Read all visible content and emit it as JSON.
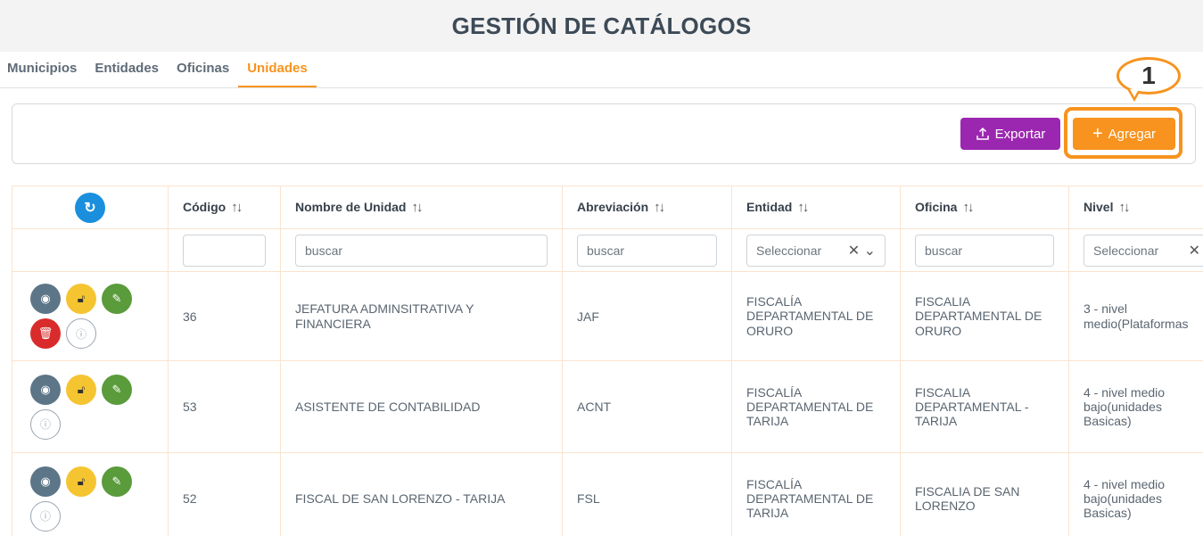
{
  "page": {
    "title": "GESTIÓN DE CATÁLOGOS"
  },
  "tabs": [
    "Municipios",
    "Entidades",
    "Oficinas",
    "Unidades"
  ],
  "active_tab": "Unidades",
  "toolbar": {
    "export_label": "Exportar",
    "add_label": "Agregar"
  },
  "annotation": {
    "callout_number": "1"
  },
  "table": {
    "columns": [
      "Código",
      "Nombre de Unidad",
      "Abreviación",
      "Entidad",
      "Oficina",
      "Nivel"
    ],
    "filters": {
      "codigo": "",
      "nombre_placeholder": "buscar",
      "abreviacion_placeholder": "buscar",
      "entidad_placeholder": "Seleccionar",
      "oficina_placeholder": "buscar",
      "nivel_placeholder": "Seleccionar"
    },
    "rows": [
      {
        "codigo": "36",
        "nombre": "JEFATURA ADMINSITRATIVA Y FINANCIERA",
        "abreviacion": "JAF",
        "entidad": "FISCALÍA DEPARTAMENTAL DE ORURO",
        "oficina": "FISCALIA DEPARTAMENTAL DE ORURO",
        "nivel": "3 - nivel medio(Plataformas"
      },
      {
        "codigo": "53",
        "nombre": "ASISTENTE DE CONTABILIDAD",
        "abreviacion": "ACNT",
        "entidad": "FISCALÍA DEPARTAMENTAL DE TARIJA",
        "oficina": "FISCALIA DEPARTAMENTAL - TARIJA",
        "nivel": "4 - nivel medio bajo(unidades Basicas)"
      },
      {
        "codigo": "52",
        "nombre": "FISCAL DE SAN LORENZO - TARIJA",
        "abreviacion": "FSL",
        "entidad": "FISCALÍA DEPARTAMENTAL DE TARIJA",
        "oficina": "FISCALIA DE SAN LORENZO",
        "nivel": "4 - nivel medio bajo(unidades Basicas)"
      }
    ]
  },
  "icons": {
    "refresh": "refresh-icon",
    "view": "eye-icon",
    "unlock": "unlock-icon",
    "edit": "pencil-icon",
    "delete": "trash-icon",
    "info": "info-icon",
    "export": "upload-icon",
    "add": "plus-icon",
    "sort": "sort-icon"
  },
  "colors": {
    "accent": "#f7931e",
    "export": "#9b27b0",
    "refresh": "#1a8fdd",
    "view": "#5c7688",
    "unlock": "#f5c431",
    "edit": "#5a9b3b",
    "delete": "#d92b2b"
  }
}
